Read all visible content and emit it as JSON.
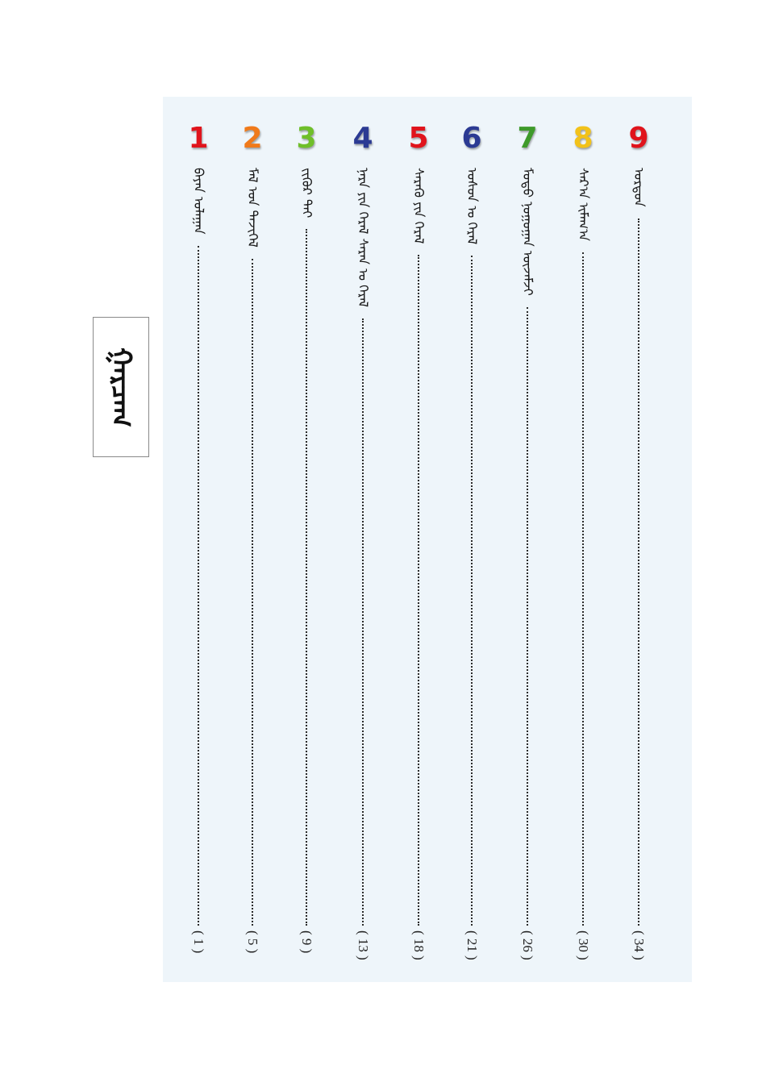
{
  "page": {
    "title": "ᠭᠠᠷᠴᠠᠭ"
  },
  "toc": {
    "entries": [
      {
        "number": "1",
        "title": "ᠪᠠᠶᠠᠨ ᠤᠯᠠᠭᠠᠨ",
        "page": "( 1 )",
        "color": "#e0141c"
      },
      {
        "number": "2",
        "title": "ᠮᠠᠯ ᠤᠨ ᠲᠡᠵᠢᠭᠡᠯ",
        "page": "( 5 )",
        "color": "#f07a1a"
      },
      {
        "number": "3",
        "title": "ᠵᠢᠭᠦᠷ ᠲᠠᠢ",
        "page": "( 9 )",
        "color": "#6fbf2a"
      },
      {
        "number": "4",
        "title": "ᠨᠠᠷᠠ ᠶᠢᠨ ᠭᠡᠷᠡᠯ ᠰᠠᠷᠠᠨ ᠤ ᠭᠡᠷᠡᠯ",
        "page": "( 13 )",
        "color": "#2b3a93"
      },
      {
        "number": "5",
        "title": "ᠰᠡᠷᠡᠬᠦ ᠶᠢᠨ ᠭᠡᠷᠡᠯ",
        "page": "( 18 )",
        "color": "#e0141c"
      },
      {
        "number": "6",
        "title": "ᠤᠰᠤᠨ ᠤ ᠭᠡᠷᠡᠯ",
        "page": "( 21 )",
        "color": "#2b3a93"
      },
      {
        "number": "7",
        "title": "ᠮᠣᠳᠣ ᠨᠣᠭᠣᠭᠠᠨ ᠦᠵᠡᠮᠵᠢ",
        "page": "( 26 )",
        "color": "#3e9a2a"
      },
      {
        "number": "8",
        "title": "ᠰᠠᠷ᠎ᠠ ᠢᠮᠠᠭ᠎ᠠ",
        "page": "( 30 )",
        "color": "#f2c21a"
      },
      {
        "number": "9",
        "title": "ᠣᠷᠳᠣᠨ",
        "page": "( 34 )",
        "color": "#e0141c"
      }
    ]
  }
}
